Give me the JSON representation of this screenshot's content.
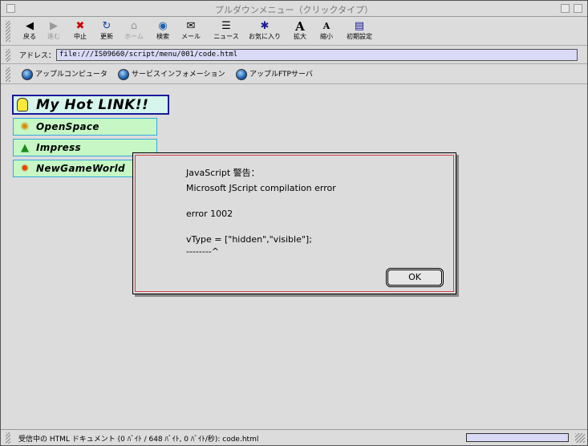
{
  "window": {
    "title": "プルダウンメニュー（クリックタイプ）"
  },
  "toolbar": {
    "buttons": [
      {
        "label": "戻る",
        "icon": "◀",
        "icon_name": "back-arrow-icon"
      },
      {
        "label": "進む",
        "icon": "▶",
        "icon_name": "forward-arrow-icon"
      },
      {
        "label": "中止",
        "icon": "✖",
        "icon_name": "stop-icon"
      },
      {
        "label": "更新",
        "icon": "↻",
        "icon_name": "refresh-icon"
      },
      {
        "label": "ホーム",
        "icon": "⌂",
        "icon_name": "home-icon"
      },
      {
        "label": "検索",
        "icon": "◉",
        "icon_name": "search-globe-icon"
      },
      {
        "label": "メール",
        "icon": "✉",
        "icon_name": "mail-icon"
      },
      {
        "label": "ニュース",
        "icon": "☰",
        "icon_name": "news-icon"
      },
      {
        "label": "お気に入り",
        "icon": "✱",
        "icon_name": "favorites-folder-icon"
      },
      {
        "label": "拡大",
        "icon": "A",
        "icon_name": "enlarge-font-icon"
      },
      {
        "label": "縮小",
        "icon": "A",
        "icon_name": "shrink-font-icon"
      },
      {
        "label": "初期設定",
        "icon": "▤",
        "icon_name": "preferences-icon"
      }
    ]
  },
  "address": {
    "label": "アドレス：",
    "value": "file:///IS09660/script/menu/001/code.html"
  },
  "favorites": [
    {
      "label": "アップルコンピュータ"
    },
    {
      "label": "サービスインフォメーション"
    },
    {
      "label": "アップルFTPサーバ"
    }
  ],
  "menu": {
    "header": "My Hot LINK!!",
    "items": [
      {
        "label": "OpenSpace",
        "icon": "✺"
      },
      {
        "label": "Impress",
        "icon": "▲"
      },
      {
        "label": "NewGameWorld",
        "icon": "✹"
      }
    ]
  },
  "dialog": {
    "title": "JavaScript 警告：",
    "error_type": "Microsoft JScript compilation error",
    "error_code": "error 1002",
    "code_line": "vType = [\"hidden\",\"visible\"];",
    "caret_line": "--------^",
    "ok_label": "OK"
  },
  "status": {
    "text": "受信中の HTML ドキュメント (0 ﾊﾞｲﾄ / 648 ﾊﾞｲﾄ, 0 ﾊﾞｲﾄ/秒): code.html",
    "progress": 0
  },
  "colors": {
    "address_bg": "#d8daf6",
    "menu_header_border": "#1a1a9a",
    "menu_item_bg": "#c6f7c4",
    "menu_item_border": "#33aadd",
    "dialog_inner_border": "#cc4444"
  }
}
